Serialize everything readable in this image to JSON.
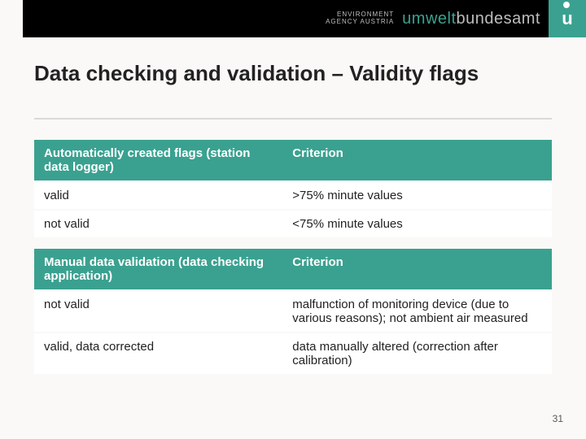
{
  "header": {
    "agency_line1": "ENVIRONMENT",
    "agency_line2": "AGENCY AUSTRIA",
    "brand_teal": "umwelt",
    "brand_grey": "bundesamt",
    "logo_letter": "u"
  },
  "title": "Data checking and validation – Validity flags",
  "table1": {
    "head": {
      "c1": "Automatically created flags (station data logger)",
      "c2": "Criterion"
    },
    "rows": [
      {
        "c1": "valid",
        "c2": ">75% minute values"
      },
      {
        "c1": "not valid",
        "c2": "<75% minute values"
      }
    ]
  },
  "table2": {
    "head": {
      "c1": "Manual data validation (data checking application)",
      "c2": "Criterion"
    },
    "rows": [
      {
        "c1": "not valid",
        "c2": "malfunction of monitoring device (due to various reasons); not ambient air measured"
      },
      {
        "c1": "valid, data corrected",
        "c2": "data manually altered (correction after calibration)"
      }
    ]
  },
  "page_number": "31"
}
